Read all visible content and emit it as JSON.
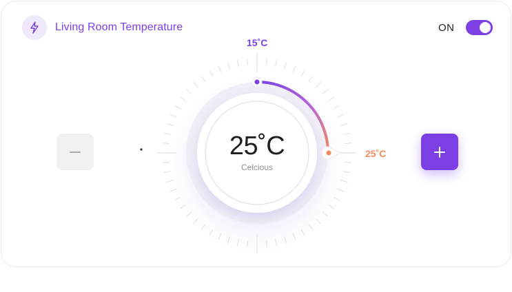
{
  "header": {
    "title": "Living Room Temperature",
    "icon": "lightning-icon"
  },
  "power": {
    "label": "ON",
    "enabled": true
  },
  "dial": {
    "min_label": "15˚C",
    "current_label": "25˚C",
    "display_value": "25˚C",
    "unit_text": "Celcious",
    "min": 15,
    "current": 25
  },
  "controls": {
    "decrease_icon": "minus-icon",
    "increase_icon": "plus-icon"
  },
  "colors": {
    "accent": "#7b3fe4",
    "warm": "#ef8a5d",
    "card_border": "#e9e9ef"
  }
}
